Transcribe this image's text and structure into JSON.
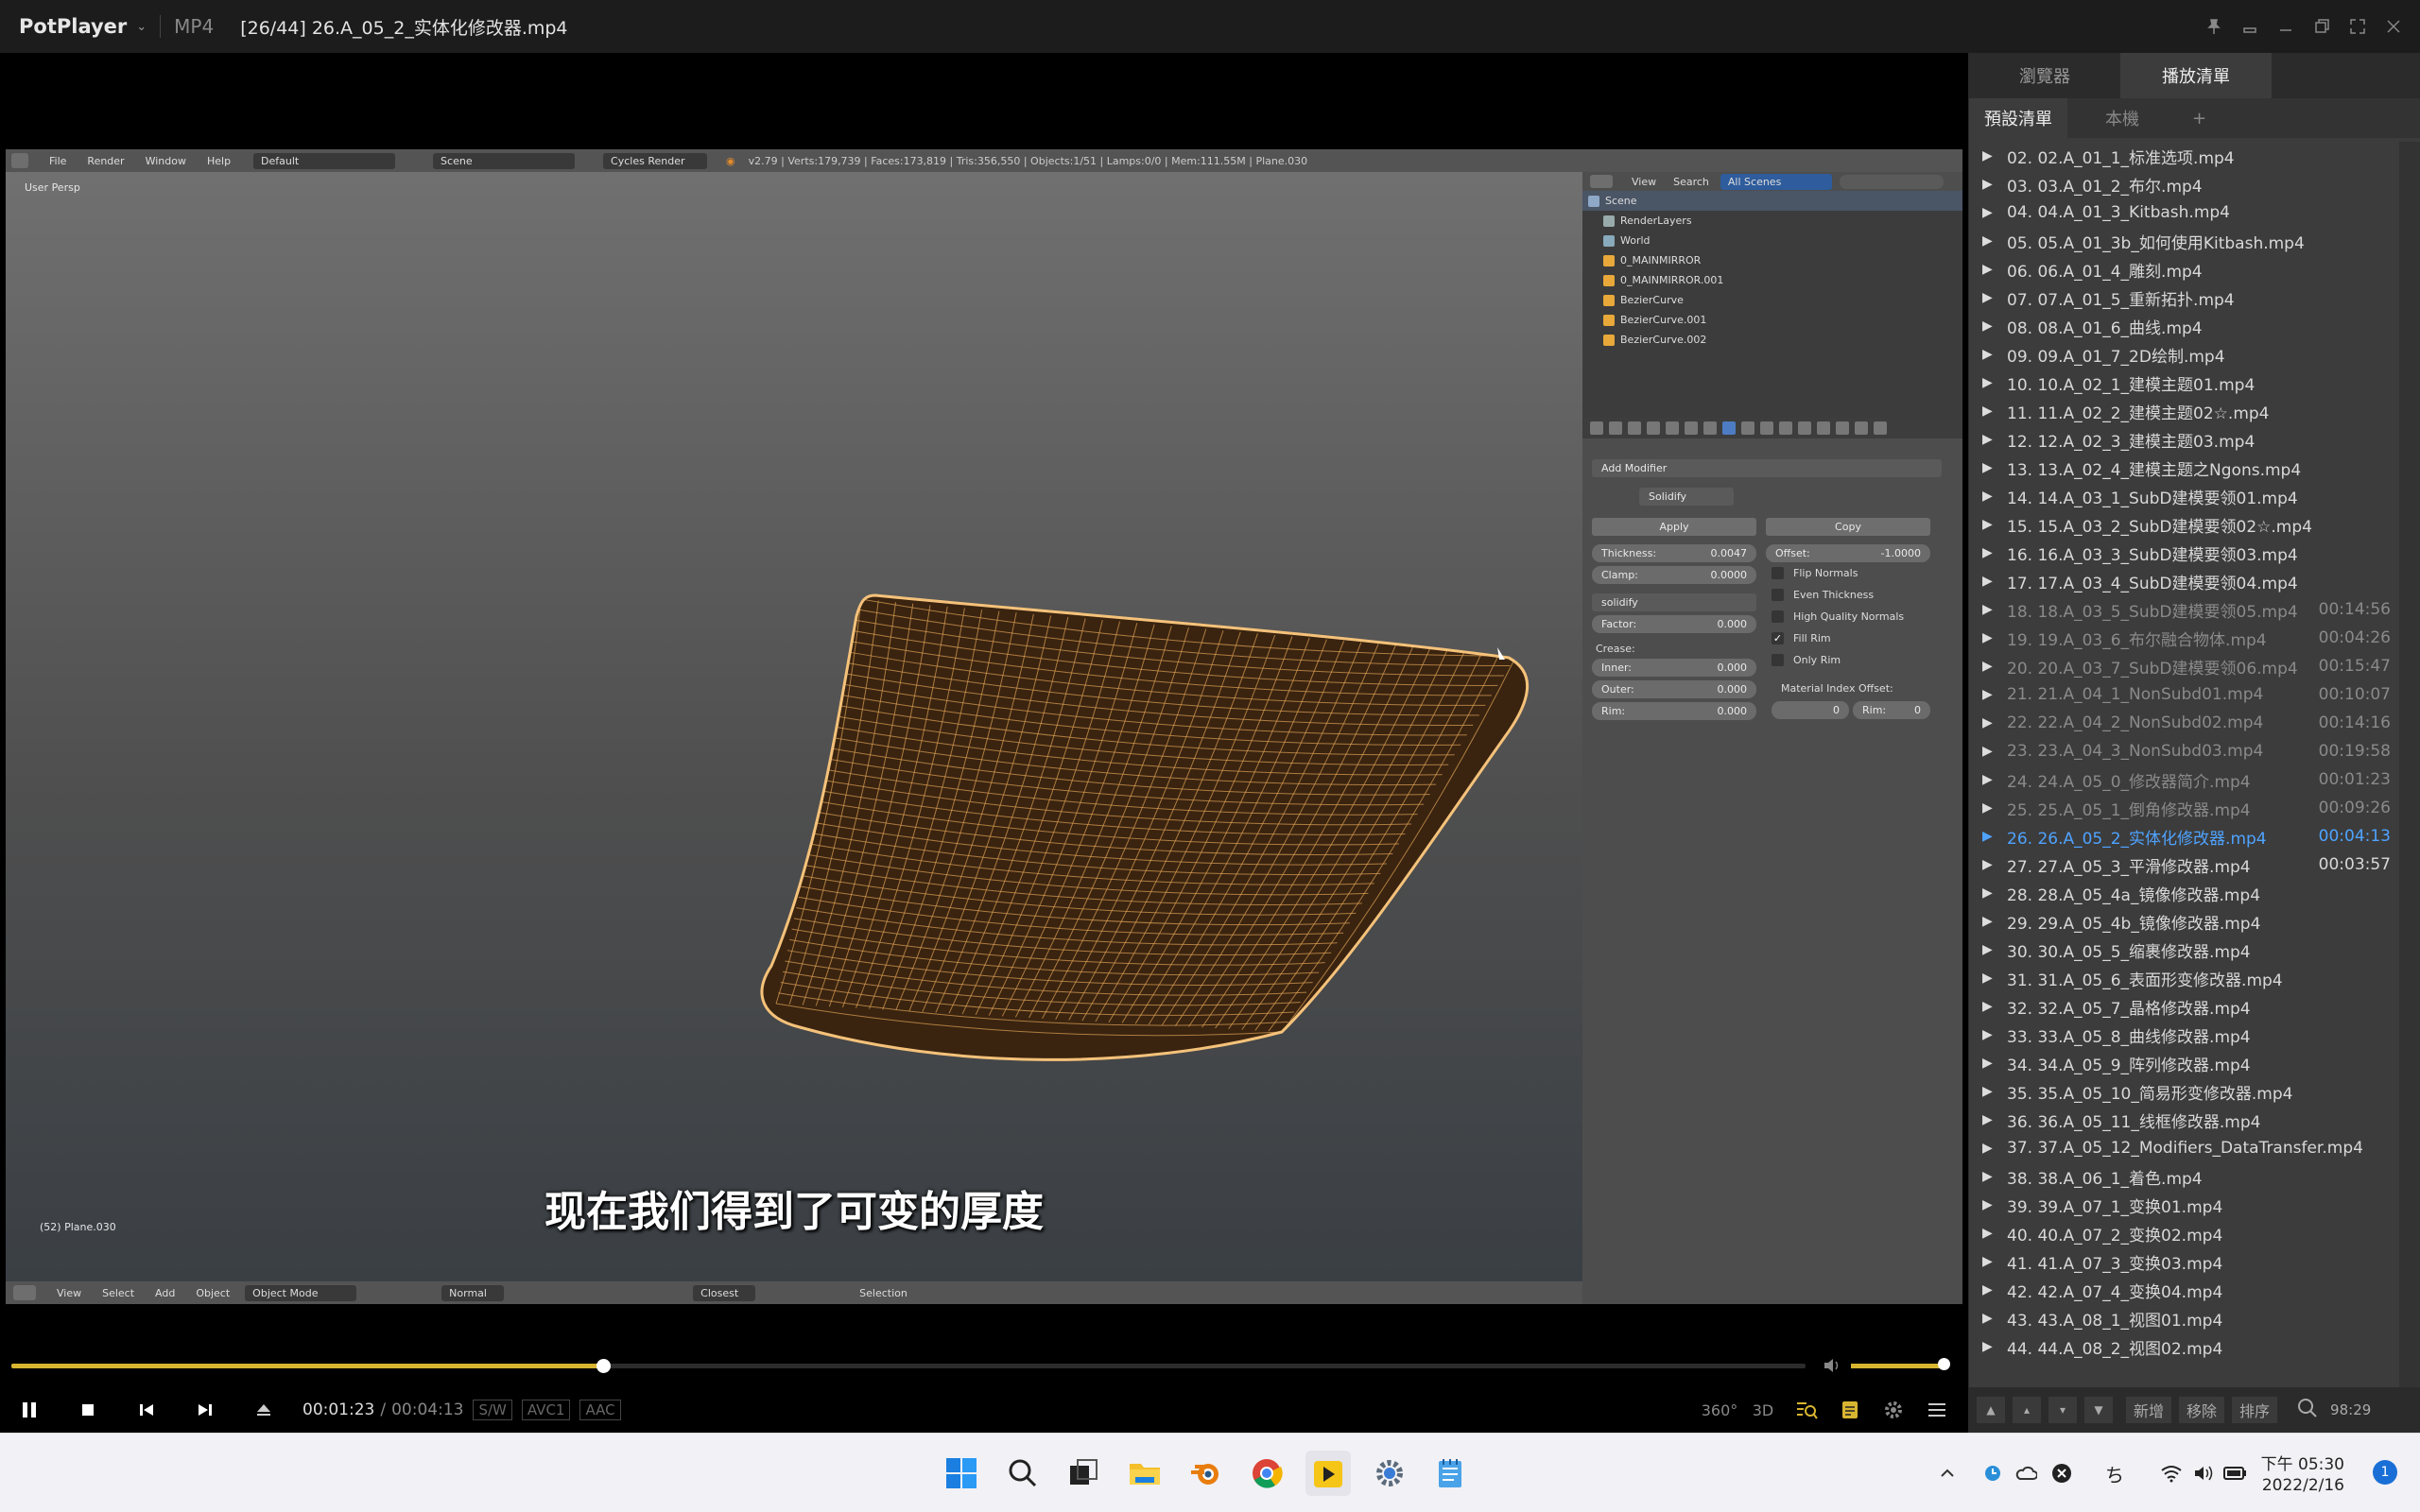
{
  "window": {
    "app_name": "PotPlayer",
    "format": "MP4",
    "title": "[26/44] 26.A_05_2_实体化修改器.mp4"
  },
  "blender": {
    "menus": [
      "File",
      "Render",
      "Window",
      "Help"
    ],
    "layout": "Default",
    "scene": "Scene",
    "engine": "Cycles Render",
    "stats": "v2.79 | Verts:179,739 | Faces:173,819 | Tris:356,550 | Objects:1/51 | Lamps:0/0 | Mem:111.55M | Plane.030",
    "viewport_label": "User Persp",
    "object_label": "(52) Plane.030",
    "bottom_menus": [
      "View",
      "Select",
      "Add",
      "Object"
    ],
    "mode": "Object Mode",
    "pivot": "Normal",
    "snap": "Closest",
    "selection": "Selection",
    "outliner": {
      "menus": [
        "View",
        "Search"
      ],
      "filter": "All Scenes",
      "items": [
        "Scene",
        "RenderLayers",
        "World",
        "0_MAINMIRROR",
        "0_MAINMIRROR.001",
        "BezierCurve",
        "BezierCurve.001",
        "BezierCurve.002"
      ]
    },
    "modifier": {
      "add_label": "Add Modifier",
      "name": "Solidify",
      "apply": "Apply",
      "copy": "Copy",
      "thickness_label": "Thickness:",
      "thickness": "0.0047",
      "offset_label": "Offset:",
      "offset": "-1.0000",
      "clamp_label": "Clamp:",
      "clamp": "0.0000",
      "vgroup": "solidify",
      "factor_label": "Factor:",
      "factor": "0.000",
      "crease_label": "Crease:",
      "inner_label": "Inner:",
      "inner": "0.000",
      "outer_label": "Outer:",
      "outer": "0.000",
      "rim_label": "Rim:",
      "rim": "0.000",
      "flip_normals": "Flip Normals",
      "even_thickness": "Even Thickness",
      "high_quality_normals": "High Quality Normals",
      "fill_rim": "Fill Rim",
      "only_rim": "Only Rim",
      "material_offset_label": "Material Index Offset:",
      "mat_offset": "0",
      "mat_rim_label": "Rim:",
      "mat_rim": "0"
    }
  },
  "subtitle": "现在我们得到了可变的厚度",
  "player": {
    "progress_fraction": 0.33,
    "volume_fraction": 1.0,
    "current_time": "00:01:23",
    "separator": "/",
    "total_time": "00:04:13",
    "tags": [
      "S/W",
      "AVC1",
      "AAC"
    ],
    "right_buttons": [
      "360°",
      "3D"
    ]
  },
  "playlist": {
    "tabs": [
      "瀏覽器",
      "播放清單"
    ],
    "subtabs": [
      "預設清單",
      "本機",
      "+"
    ],
    "items": [
      {
        "name": "02. 02.A_01_1_标准选项.mp4",
        "duration": ""
      },
      {
        "name": "03. 03.A_01_2_布尔.mp4",
        "duration": ""
      },
      {
        "name": "04. 04.A_01_3_Kitbash.mp4",
        "duration": ""
      },
      {
        "name": "05. 05.A_01_3b_如何使用Kitbash.mp4",
        "duration": ""
      },
      {
        "name": "06. 06.A_01_4_雕刻.mp4",
        "duration": ""
      },
      {
        "name": "07. 07.A_01_5_重新拓扑.mp4",
        "duration": ""
      },
      {
        "name": "08. 08.A_01_6_曲线.mp4",
        "duration": ""
      },
      {
        "name": "09. 09.A_01_7_2D绘制.mp4",
        "duration": ""
      },
      {
        "name": "10. 10.A_02_1_建模主题01.mp4",
        "duration": ""
      },
      {
        "name": "11. 11.A_02_2_建模主题02☆.mp4",
        "duration": ""
      },
      {
        "name": "12. 12.A_02_3_建模主题03.mp4",
        "duration": ""
      },
      {
        "name": "13. 13.A_02_4_建模主题之Ngons.mp4",
        "duration": ""
      },
      {
        "name": "14. 14.A_03_1_SubD建模要领01.mp4",
        "duration": ""
      },
      {
        "name": "15. 15.A_03_2_SubD建模要领02☆.mp4",
        "duration": ""
      },
      {
        "name": "16. 16.A_03_3_SubD建模要领03.mp4",
        "duration": ""
      },
      {
        "name": "17. 17.A_03_4_SubD建模要领04.mp4",
        "duration": ""
      },
      {
        "name": "18. 18.A_03_5_SubD建模要领05.mp4",
        "duration": "00:14:56"
      },
      {
        "name": "19. 19.A_03_6_布尔融合物体.mp4",
        "duration": "00:04:26"
      },
      {
        "name": "20. 20.A_03_7_SubD建模要领06.mp4",
        "duration": "00:15:47"
      },
      {
        "name": "21. 21.A_04_1_NonSubd01.mp4",
        "duration": "00:10:07"
      },
      {
        "name": "22. 22.A_04_2_NonSubd02.mp4",
        "duration": "00:14:16"
      },
      {
        "name": "23. 23.A_04_3_NonSubd03.mp4",
        "duration": "00:19:58"
      },
      {
        "name": "24. 24.A_05_0_修改器简介.mp4",
        "duration": "00:01:23"
      },
      {
        "name": "25. 25.A_05_1_倒角修改器.mp4",
        "duration": "00:09:26"
      },
      {
        "name": "26. 26.A_05_2_实体化修改器.mp4",
        "duration": "00:04:13"
      },
      {
        "name": "27. 27.A_05_3_平滑修改器.mp4",
        "duration": "00:03:57"
      },
      {
        "name": "28. 28.A_05_4a_镜像修改器.mp4",
        "duration": ""
      },
      {
        "name": "29. 29.A_05_4b_镜像修改器.mp4",
        "duration": ""
      },
      {
        "name": "30. 30.A_05_5_缩裹修改器.mp4",
        "duration": ""
      },
      {
        "name": "31. 31.A_05_6_表面形变修改器.mp4",
        "duration": ""
      },
      {
        "name": "32. 32.A_05_7_晶格修改器.mp4",
        "duration": ""
      },
      {
        "name": "33. 33.A_05_8_曲线修改器.mp4",
        "duration": ""
      },
      {
        "name": "34. 34.A_05_9_阵列修改器.mp4",
        "duration": ""
      },
      {
        "name": "35. 35.A_05_10_简易形变修改器.mp4",
        "duration": ""
      },
      {
        "name": "36. 36.A_05_11_线框修改器.mp4",
        "duration": ""
      },
      {
        "name": "37. 37.A_05_12_Modifiers_DataTransfer.mp4",
        "duration": ""
      },
      {
        "name": "38. 38.A_06_1_着色.mp4",
        "duration": ""
      },
      {
        "name": "39. 39.A_07_1_变换01.mp4",
        "duration": ""
      },
      {
        "name": "40. 40.A_07_2_变换02.mp4",
        "duration": ""
      },
      {
        "name": "41. 41.A_07_3_变换03.mp4",
        "duration": ""
      },
      {
        "name": "42. 42.A_07_4_变换04.mp4",
        "duration": ""
      },
      {
        "name": "43. 43.A_08_1_视图01.mp4",
        "duration": ""
      },
      {
        "name": "44. 44.A_08_2_视图02.mp4",
        "duration": ""
      }
    ],
    "active_index": 24,
    "footer": {
      "add": "新增",
      "remove": "移除",
      "sort": "排序",
      "count": "98:29"
    }
  },
  "taskbar": {
    "time": "下午 05:30",
    "date": "2022/2/16",
    "notifications": "1"
  },
  "colors": {
    "accent": "#d8b530",
    "active_item": "#4fa3ff",
    "played_item": "#8a8a8a",
    "mesh_wire": "#e0a355"
  }
}
